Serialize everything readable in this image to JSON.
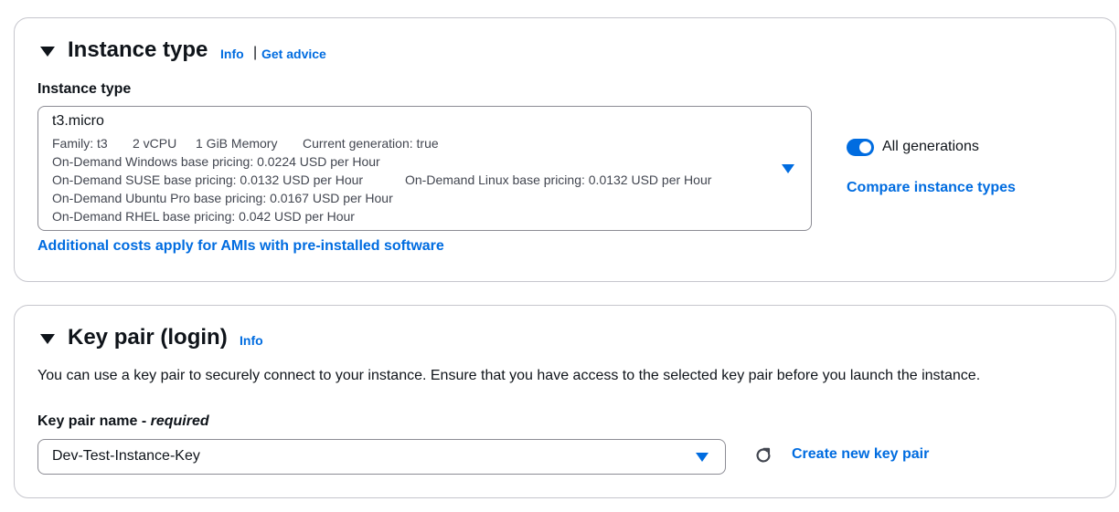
{
  "instance_type_panel": {
    "title": "Instance type",
    "info_link": "Info",
    "separator": "|",
    "advice_link": "Get advice",
    "field_label": "Instance type",
    "selected": {
      "name": "t3.micro",
      "family": "Family: t3",
      "vcpu": "2 vCPU",
      "memory": "1 GiB Memory",
      "generation": "Current generation: true",
      "windows_pricing": "On-Demand Windows base pricing: 0.0224 USD per Hour",
      "suse_pricing": "On-Demand SUSE base pricing: 0.0132 USD per Hour",
      "linux_pricing": "On-Demand Linux base pricing: 0.0132 USD per Hour",
      "ubuntu_pricing": "On-Demand Ubuntu Pro base pricing: 0.0167 USD per Hour",
      "rhel_pricing": "On-Demand RHEL base pricing: 0.042 USD per Hour"
    },
    "additional_costs_link": "Additional costs apply for AMIs with pre-installed software",
    "toggle_label": "All generations",
    "toggle_on": true,
    "compare_link": "Compare instance types"
  },
  "key_pair_panel": {
    "title": "Key pair (login)",
    "info_link": "Info",
    "description": "You can use a key pair to securely connect to your instance. Ensure that you have access to the selected key pair before you launch the instance.",
    "field_label": "Key pair name - ",
    "field_required": "required",
    "selected_value": "Dev-Test-Instance-Key",
    "create_link": "Create new key pair"
  },
  "colors": {
    "link": "#006ce0",
    "text": "#0f141a",
    "secondary_text": "#424650",
    "border": "#c6c6cd"
  }
}
